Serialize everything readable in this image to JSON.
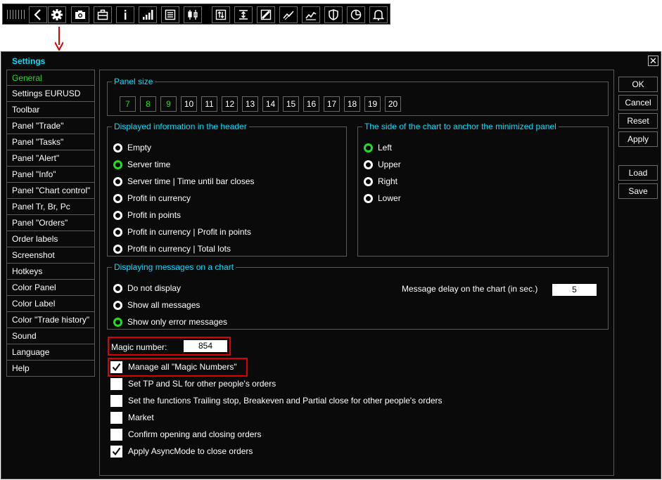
{
  "toolbar": {
    "icons": [
      "grip-icon",
      "back-arrow-icon",
      "gear-icon",
      "camera-icon",
      "briefcase-icon",
      "info-icon",
      "signal-bars-icon",
      "list-icon",
      "candles-icon",
      "chart-control-icon",
      "anchor-line-icon",
      "ruler-icon",
      "trend-icon",
      "zigzag-icon",
      "shield-icon",
      "pie-chart-icon",
      "bell-icon"
    ]
  },
  "window": {
    "title": "Settings",
    "close_glyph": "✕"
  },
  "sidebar": {
    "items": [
      {
        "label": "General",
        "active": true
      },
      {
        "label": "Settings EURUSD"
      },
      {
        "label": "Toolbar"
      },
      {
        "label": "Panel \"Trade\""
      },
      {
        "label": "Panel \"Tasks\""
      },
      {
        "label": "Panel \"Alert\""
      },
      {
        "label": "Panel \"Info\""
      },
      {
        "label": "Panel \"Chart control\""
      },
      {
        "label": "Panel Tr, Br, Pc"
      },
      {
        "label": "Panel \"Orders\""
      },
      {
        "label": "Order labels"
      },
      {
        "label": "Screenshot"
      },
      {
        "label": "Hotkeys"
      },
      {
        "label": "Color Panel"
      },
      {
        "label": "Color Label"
      },
      {
        "label": "Color \"Trade history\""
      },
      {
        "label": "Sound"
      },
      {
        "label": "Language"
      },
      {
        "label": "Help"
      }
    ]
  },
  "panel_size": {
    "legend": "Panel size",
    "options": [
      "7",
      "8",
      "9",
      "10",
      "11",
      "12",
      "13",
      "14",
      "15",
      "16",
      "17",
      "18",
      "19",
      "20"
    ],
    "green_count": 3
  },
  "header_info": {
    "legend": "Displayed information in the header",
    "options": [
      "Empty",
      "Server time",
      "Server time | Time until bar closes",
      "Profit in currency",
      "Profit in points",
      "Profit in currency | Profit in points",
      "Profit in currency | Total lots"
    ],
    "selected": 1
  },
  "anchor_side": {
    "legend": "The side of the chart to anchor the minimized panel",
    "options": [
      "Left",
      "Upper",
      "Right",
      "Lower"
    ],
    "selected": 0
  },
  "messages": {
    "legend": "Displaying messages on a chart",
    "options": [
      "Do not display",
      "Show all messages",
      "Show only error messages"
    ],
    "selected": 2,
    "delay_label": "Message delay on the chart (in sec.)",
    "delay_value": "5"
  },
  "magic": {
    "label": "Magic number:",
    "value": "854"
  },
  "checkboxes": [
    {
      "label": "Manage all \"Magic Numbers\"",
      "checked": true
    },
    {
      "label": "Set TP and SL for other people's orders",
      "checked": false
    },
    {
      "label": "Set the functions Trailing stop, Breakeven and Partial close for other people's orders",
      "checked": false
    },
    {
      "label": "Market",
      "checked": false
    },
    {
      "label": "Confirm opening and closing orders",
      "checked": false
    },
    {
      "label": "Apply AsyncMode to close orders",
      "checked": true
    }
  ],
  "buttons": {
    "ok": "OK",
    "cancel": "Cancel",
    "reset": "Reset",
    "apply": "Apply",
    "load": "Load",
    "save": "Save"
  },
  "colors": {
    "accent_cyan": "#00e0ff",
    "active_green": "#22dd22",
    "highlight_red": "#e00000",
    "background": "#0a0a0a"
  }
}
